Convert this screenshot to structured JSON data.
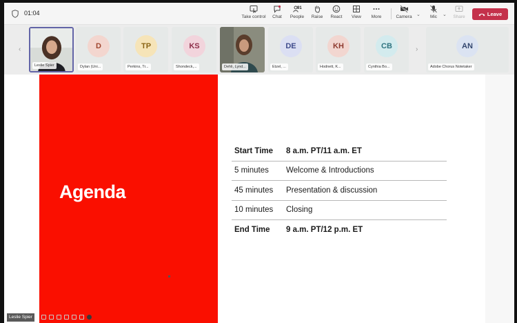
{
  "topbar": {
    "timer": "01:04",
    "buttons": [
      {
        "label": "Take control",
        "icon": "take-control-icon"
      },
      {
        "label": "Chat",
        "icon": "chat-icon"
      },
      {
        "label": "People",
        "icon": "people-icon",
        "count": "91"
      },
      {
        "label": "Raise",
        "icon": "raise-hand-icon"
      },
      {
        "label": "React",
        "icon": "react-icon"
      },
      {
        "label": "View",
        "icon": "view-icon"
      },
      {
        "label": "More",
        "icon": "more-icon"
      },
      {
        "label": "Camera",
        "icon": "camera-icon"
      },
      {
        "label": "Mic",
        "icon": "mic-icon"
      },
      {
        "label": "Share",
        "icon": "share-icon"
      }
    ],
    "leave_label": "Leave",
    "leave_color": "#c4314b"
  },
  "gallery": {
    "participants": [
      {
        "name": "Leslie Spier",
        "initials": "",
        "video": true
      },
      {
        "name": "Dylan (Uni...",
        "initials": "D",
        "color": "#f3d6cf",
        "text": "#a0462f"
      },
      {
        "name": "Perkins, Tr...",
        "initials": "TP",
        "color": "#f6e4b8",
        "text": "#8a6414"
      },
      {
        "name": "Shondeck,...",
        "initials": "KS",
        "color": "#f2d4dc",
        "text": "#8e2f4a"
      },
      {
        "name": "Dehli, Lynd...",
        "initials": "",
        "video": true
      },
      {
        "name": "Etzel, ...",
        "initials": "DE",
        "color": "#dbdff3",
        "text": "#3f4b8c"
      },
      {
        "name": "Hodnett, K...",
        "initials": "KH",
        "color": "#f2d6d0",
        "text": "#8e3a2f"
      },
      {
        "name": "Cynthia Bo...",
        "initials": "CB",
        "color": "#d3ebee",
        "text": "#2f7480"
      },
      {
        "name": "Adobe Chorus Notetaker",
        "initials": "AN",
        "color": "#dbe3f2",
        "text": "#33466e"
      }
    ]
  },
  "slide": {
    "title": "Agenda",
    "accent": "#fa0f00",
    "rows": [
      {
        "c1": "Start Time",
        "c2": "8 a.m. PT/11 a.m. ET",
        "bold": true
      },
      {
        "c1": "5 minutes",
        "c2": "Welcome & Introductions",
        "bold": false
      },
      {
        "c1": "45 minutes",
        "c2": "Presentation & discussion",
        "bold": false
      },
      {
        "c1": "10 minutes",
        "c2": "Closing",
        "bold": false
      },
      {
        "c1": "End Time",
        "c2": "9 a.m. PT/12 p.m. ET",
        "bold": true
      }
    ]
  },
  "presenter": {
    "name": "Leslie Spier"
  }
}
